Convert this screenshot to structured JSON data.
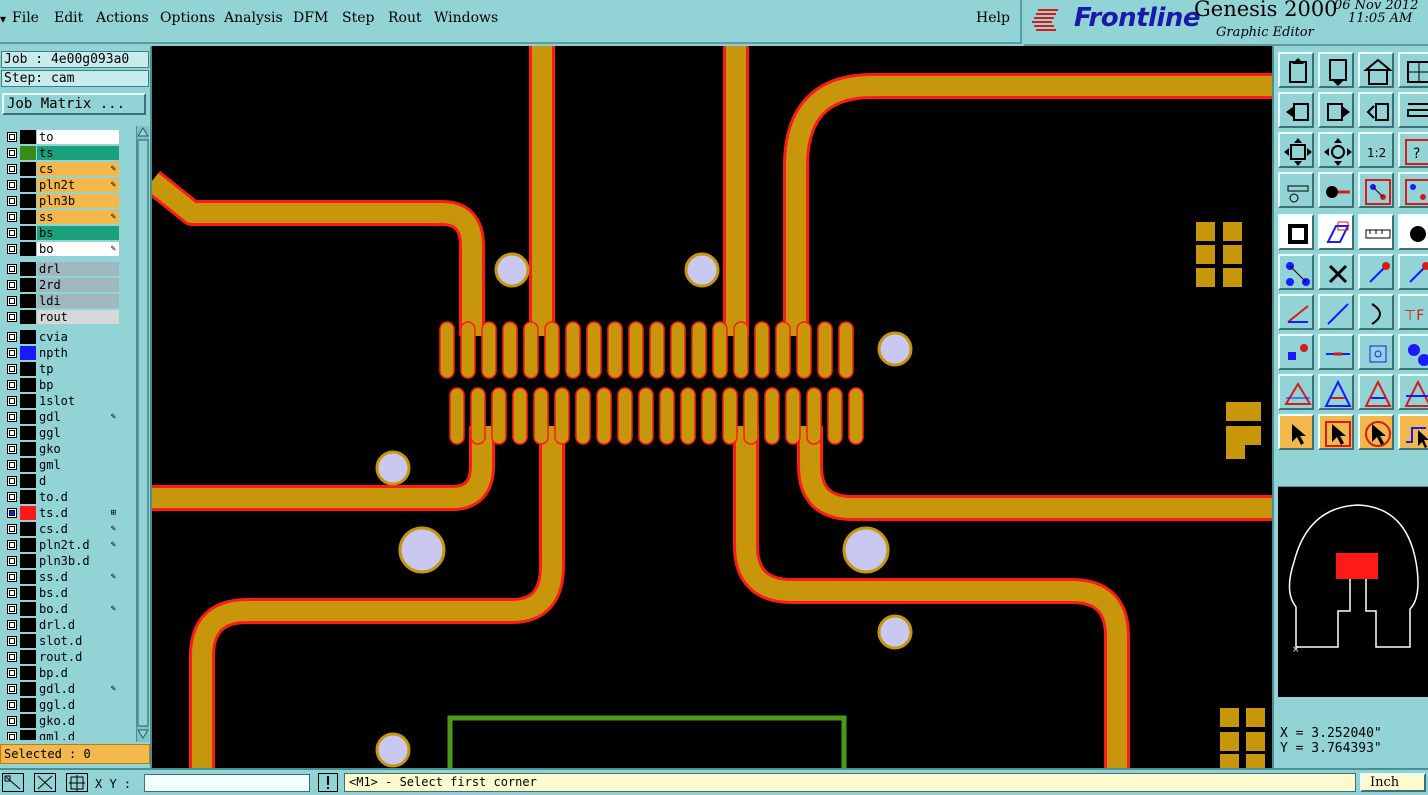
{
  "menu": {
    "file": "File",
    "edit": "Edit",
    "actions": "Actions",
    "options": "Options",
    "analysis": "Analysis",
    "dfm": "DFM",
    "step": "Step",
    "rout": "Rout",
    "windows": "Windows",
    "help": "Help"
  },
  "brand": {
    "logo": "Frontline",
    "product": "Genesis 2000",
    "subtitle": "Graphic Editor",
    "date": "06 Nov 2012",
    "time": "11:05 AM"
  },
  "left": {
    "job": "Job : 4e00g093a0",
    "step": "Step: cam",
    "job_matrix": "Job Matrix ...",
    "selected": "Selected : 0"
  },
  "layers": [
    {
      "name": "to",
      "color": "#ffffff",
      "swatch": "#000000",
      "icon": ""
    },
    {
      "name": "ts",
      "color": "#1aa07a",
      "swatch": "#3a8a1a",
      "icon": ""
    },
    {
      "name": "cs",
      "color": "#f2b84b",
      "swatch": "#000000",
      "icon": "✎"
    },
    {
      "name": "pln2t",
      "color": "#f2b84b",
      "swatch": "#000000",
      "icon": "✎"
    },
    {
      "name": "pln3b",
      "color": "#f2b84b",
      "swatch": "#000000",
      "icon": ""
    },
    {
      "name": "ss",
      "color": "#f2b84b",
      "swatch": "#000000",
      "icon": "✎"
    },
    {
      "name": "bs",
      "color": "#1aa07a",
      "swatch": "#000000",
      "icon": ""
    },
    {
      "name": "bo",
      "color": "#ffffff",
      "swatch": "#000000",
      "icon": "✎"
    },
    {
      "name": "drl",
      "color": "#9fb8c0",
      "swatch": "#000000",
      "icon": ""
    },
    {
      "name": "2rd",
      "color": "#9fb8c0",
      "swatch": "#000000",
      "icon": ""
    },
    {
      "name": "ldi",
      "color": "#9fb8c0",
      "swatch": "#000000",
      "icon": ""
    },
    {
      "name": "rout",
      "color": "#d8d8d8",
      "swatch": "#000000",
      "icon": ""
    },
    {
      "name": "cvia",
      "color": "#92d3d6",
      "swatch": "#000000",
      "icon": ""
    },
    {
      "name": "npth",
      "color": "#92d3d6",
      "swatch": "#1a1aff",
      "icon": ""
    },
    {
      "name": "tp",
      "color": "#92d3d6",
      "swatch": "#000000",
      "icon": ""
    },
    {
      "name": "bp",
      "color": "#92d3d6",
      "swatch": "#000000",
      "icon": ""
    },
    {
      "name": "1slot",
      "color": "#92d3d6",
      "swatch": "#000000",
      "icon": ""
    },
    {
      "name": "gdl",
      "color": "#92d3d6",
      "swatch": "#000000",
      "icon": "✎"
    },
    {
      "name": "ggl",
      "color": "#92d3d6",
      "swatch": "#000000",
      "icon": ""
    },
    {
      "name": "gko",
      "color": "#92d3d6",
      "swatch": "#000000",
      "icon": ""
    },
    {
      "name": "gml",
      "color": "#92d3d6",
      "swatch": "#000000",
      "icon": ""
    },
    {
      "name": "d",
      "color": "#92d3d6",
      "swatch": "#000000",
      "icon": ""
    },
    {
      "name": "to.d",
      "color": "#92d3d6",
      "swatch": "#000000",
      "icon": ""
    },
    {
      "name": "ts.d",
      "color": "#92d3d6",
      "swatch": "#ff1a1a",
      "icon": "⊞"
    },
    {
      "name": "cs.d",
      "color": "#92d3d6",
      "swatch": "#000000",
      "icon": "✎"
    },
    {
      "name": "pln2t.d",
      "color": "#92d3d6",
      "swatch": "#000000",
      "icon": "✎"
    },
    {
      "name": "pln3b.d",
      "color": "#92d3d6",
      "swatch": "#000000",
      "icon": ""
    },
    {
      "name": "ss.d",
      "color": "#92d3d6",
      "swatch": "#000000",
      "icon": "✎"
    },
    {
      "name": "bs.d",
      "color": "#92d3d6",
      "swatch": "#000000",
      "icon": ""
    },
    {
      "name": "bo.d",
      "color": "#92d3d6",
      "swatch": "#000000",
      "icon": "✎"
    },
    {
      "name": "drl.d",
      "color": "#92d3d6",
      "swatch": "#000000",
      "icon": ""
    },
    {
      "name": "slot.d",
      "color": "#92d3d6",
      "swatch": "#000000",
      "icon": ""
    },
    {
      "name": "rout.d",
      "color": "#92d3d6",
      "swatch": "#000000",
      "icon": ""
    },
    {
      "name": "bp.d",
      "color": "#92d3d6",
      "swatch": "#000000",
      "icon": ""
    },
    {
      "name": "gdl.d",
      "color": "#92d3d6",
      "swatch": "#000000",
      "icon": "✎"
    },
    {
      "name": "ggl.d",
      "color": "#92d3d6",
      "swatch": "#000000",
      "icon": ""
    },
    {
      "name": "gko.d",
      "color": "#92d3d6",
      "swatch": "#000000",
      "icon": ""
    },
    {
      "name": "gml.d",
      "color": "#92d3d6",
      "swatch": "#000000",
      "icon": ""
    }
  ],
  "coords": {
    "x": "X = 3.252040\"",
    "y": "Y = 3.764393\""
  },
  "status": {
    "xy_label": "X Y :",
    "xy_value": "",
    "message": "<M1> - Select first corner",
    "unit": "Inch"
  },
  "colors": {
    "trace": "#c8960a",
    "outline": "#ff1a1a",
    "via": "#c8c8f0",
    "panel": "#92d3d6",
    "rect": "#4a9a1a"
  },
  "toolbar_icons": [
    "page-up-icon",
    "page-down-icon",
    "home-icon",
    "window-icon",
    "pan-left-icon",
    "pan-right-icon",
    "flip-icon",
    "slice-icon",
    "zoom-fit-icon",
    "zoom-center-icon",
    "ratio-icon",
    "help-icon",
    "measure-icon",
    "probe-icon",
    "snap-pad-icon",
    "snap-pad2-icon",
    "fill-icon",
    "erase-icon",
    "ruler-icon",
    "dot-icon",
    "connect-icon",
    "cross-icon",
    "line-red-icon",
    "line-red2-icon",
    "angle-icon",
    "diag-icon",
    "arc-icon",
    "pad-text-icon",
    "move-icon",
    "stretch-icon",
    "target-icon",
    "group-icon",
    "triangle-icon",
    "a-icon",
    "a-icon-2",
    "a-icon-3",
    "select-icon",
    "select-box-icon",
    "select-round-icon",
    "select-path-icon"
  ]
}
